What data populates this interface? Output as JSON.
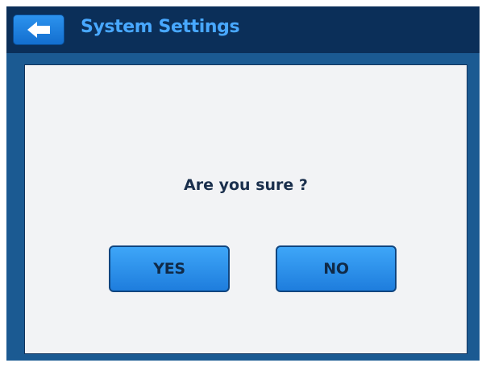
{
  "header": {
    "title": "System Settings",
    "back_icon": "arrow-left-icon"
  },
  "dialog": {
    "message": "Are you sure ?",
    "yes_label": "YES",
    "no_label": "NO"
  },
  "colors": {
    "header_background": "#0b2f59",
    "title_text": "#48a8ff",
    "screen_background": "#1b5a92",
    "dialog_background": "#f2f3f5",
    "button_blue": "#2a8ff0"
  }
}
